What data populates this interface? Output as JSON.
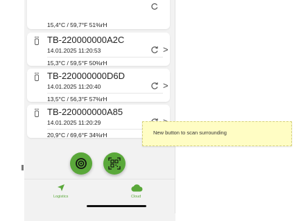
{
  "cards": [
    {
      "device_id": "",
      "timestamp": "",
      "reading": "15,4°C / 59,7°F  51%rH"
    },
    {
      "device_id": "TB-220000000A2C",
      "timestamp": "14.01.2025 11:20:53",
      "reading": "15,3°C / 59,5°F  50%rH"
    },
    {
      "device_id": "TB-220000000D6D",
      "timestamp": "14.01.2025 11:20:40",
      "reading": "13,5°C / 56,3°F  57%rH"
    },
    {
      "device_id": "TB-220000000A85",
      "timestamp": "14.01.2025 11:20:29",
      "reading": "20,9°C / 69,6°F  34%rH"
    }
  ],
  "chevron_glyph": ">",
  "buttons": {
    "nfc_scan": {
      "icon": "nfc-scan-icon"
    },
    "qr_scan": {
      "icon": "qr-code-scan-icon"
    }
  },
  "nav": {
    "logistics": {
      "label": "Logistics",
      "icon": "navigation-arrow-icon"
    },
    "cloud": {
      "label": "Cloud",
      "icon": "cloud-icon"
    }
  },
  "annotation": {
    "text": "New button to scan surrounding"
  },
  "colors": {
    "accent": "#5aa83a",
    "note_bg": "#fffdc4"
  }
}
